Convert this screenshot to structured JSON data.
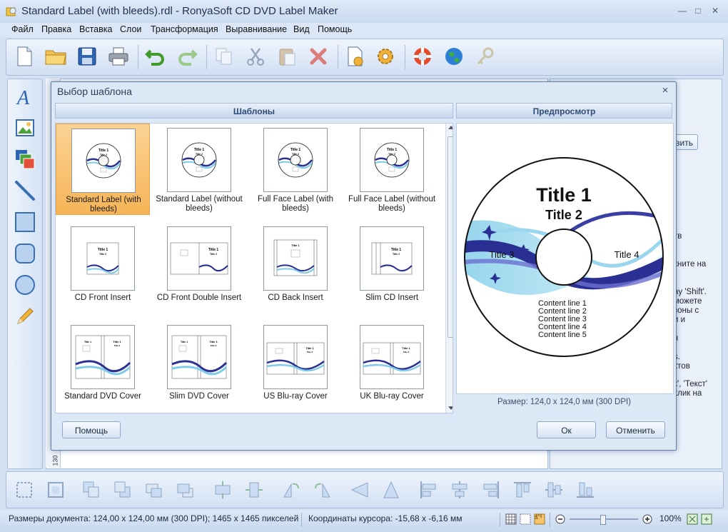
{
  "window": {
    "title": "Standard Label (with bleeds).rdl - RonyaSoft CD DVD Label Maker"
  },
  "menu": [
    "Файл",
    "Правка",
    "Вставка",
    "Слои",
    "Трансформация",
    "Выравнивание",
    "Вид",
    "Помощь"
  ],
  "toolbar": {
    "icons": [
      "new-document-icon",
      "open-folder-icon",
      "save-icon",
      "print-icon",
      "undo-icon",
      "redo-icon",
      "copy-icon",
      "cut-icon",
      "paste-icon",
      "delete-icon",
      "document-settings-icon",
      "settings-gear-icon",
      "help-lifebuoy-icon",
      "web-globe-icon",
      "register-key-icon"
    ]
  },
  "leftbar": {
    "icons": [
      "text-tool-icon",
      "image-tool-icon",
      "layers-tool-icon",
      "line-tool-icon",
      "rectangle-tool-icon",
      "rounded-rectangle-tool-icon",
      "ellipse-tool-icon",
      "pencil-tool-icon"
    ]
  },
  "ruler": {
    "label": "130"
  },
  "right_panel": {
    "button_fragment": "вить",
    "text_lines": [
      "тв",
      "кните на",
      "ay 'Shift'.",
      "можете",
      "зоны с",
      "и и",
      "я",
      "s.",
      "ктов",
      "",
      "к', 'Текст'",
      "клик на"
    ]
  },
  "dialog": {
    "title": "Выбор шаблона",
    "templates_header": "Шаблоны",
    "preview_header": "Предпросмотр",
    "templates": [
      {
        "label": "Standard Label (with bleeds)",
        "kind": "disc"
      },
      {
        "label": "Standard Label (without bleeds)",
        "kind": "disc"
      },
      {
        "label": "Full Face Label (with bleeds)",
        "kind": "disc"
      },
      {
        "label": "Full Face Label (without bleeds)",
        "kind": "disc"
      },
      {
        "label": "CD Front Insert",
        "kind": "insert"
      },
      {
        "label": "CD Front Double Insert",
        "kind": "double"
      },
      {
        "label": "CD Back Insert",
        "kind": "back"
      },
      {
        "label": "Slim CD Insert",
        "kind": "slim"
      },
      {
        "label": "Standard DVD Cover",
        "kind": "dvd"
      },
      {
        "label": "Slim DVD Cover",
        "kind": "dvd"
      },
      {
        "label": "US Blu-ray Cover",
        "kind": "bluray"
      },
      {
        "label": "UK Blu-ray Cover",
        "kind": "bluray"
      }
    ],
    "thumb_text": {
      "title1": "Title 1",
      "title2": "Title 2"
    },
    "preview": {
      "title1": "Title 1",
      "title2": "Title 2",
      "title3": "Title 3",
      "title4": "Title 4",
      "content_lines": [
        "Content line 1",
        "Content line 2",
        "Content line 3",
        "Content line 4",
        "Content line 5"
      ]
    },
    "size_text": "Размер: 124,0 x 124,0 мм (300 DPI)",
    "help_button": "Помощь",
    "ok_button": "Ок",
    "cancel_button": "Отменить"
  },
  "bottombar": {
    "icons": [
      "group-icon",
      "ungroup-icon",
      "bring-to-front-icon",
      "send-to-back-icon",
      "bring-forward-icon",
      "send-backward-icon",
      "center-horizontal-icon",
      "center-vertical-icon",
      "rotate-left-icon",
      "rotate-right-icon",
      "flip-horizontal-icon",
      "flip-vertical-icon",
      "align-left-icon",
      "align-center-icon",
      "align-right-icon",
      "align-top-icon",
      "align-middle-icon",
      "align-bottom-icon"
    ]
  },
  "statusbar": {
    "doc_size": "Размеры документа: 124,00 x 124,00 мм (300 DPI); 1465 x 1465 пикселей",
    "cursor": "Координаты курсора: -15,68 x -6,16 мм",
    "zoom": "100%"
  }
}
